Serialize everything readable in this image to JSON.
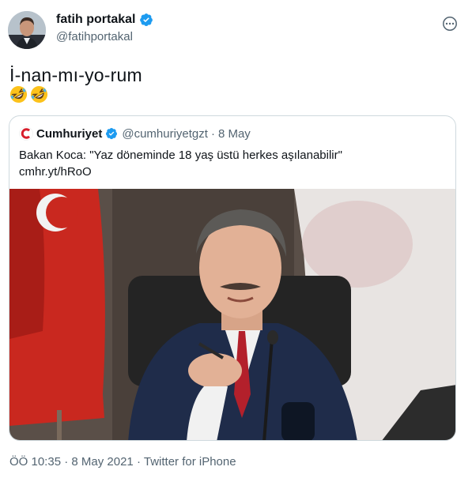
{
  "author": {
    "display_name": "fatih portakal",
    "handle": "@fatihportakal"
  },
  "tweet": {
    "text": "İ-nan-mı-yo-rum",
    "emojis": [
      "rolling-on-floor-laughing",
      "rolling-on-floor-laughing"
    ]
  },
  "quoted_tweet": {
    "display_name": "Cumhuriyet",
    "handle": "@cumhuriyetgzt",
    "separator": "·",
    "date": "8 May",
    "text": "Bakan Koca: \"Yaz döneminde 18 yaş üstü herkes aşılanabilir\"",
    "link": "cmhr.yt/hRoO"
  },
  "meta": {
    "time": "ÖÖ 10:35",
    "sep1": "·",
    "date": "8 May 2021",
    "sep2": "·",
    "source": "Twitter for iPhone"
  },
  "colors": {
    "verified": "#1d9bf0",
    "text": "#0f1419",
    "secondary": "#536471",
    "border": "#cfd9de",
    "cumhuriyet_red": "#d81e2c"
  }
}
